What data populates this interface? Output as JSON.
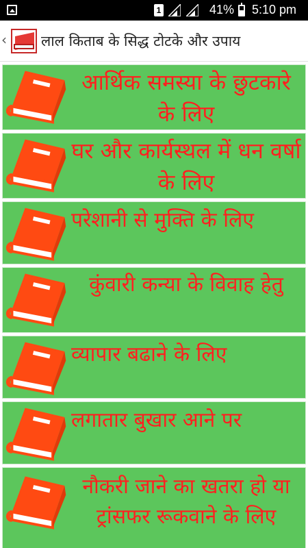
{
  "status_bar": {
    "sim_slot": "1",
    "battery_percent": "41%",
    "time": "5:10 pm"
  },
  "app_bar": {
    "back_icon": "chevron-left-icon",
    "app_icon": "red-book-icon",
    "title": "लाल किताब के सिद्ध टोटके और उपाय"
  },
  "colors": {
    "item_bg": "#5cc65c",
    "item_text": "#ff1f1f",
    "book_icon": "#ff4a12"
  },
  "items": [
    {
      "label": "आर्थिक समस्या के छुटकारे के लिए",
      "icon": "book-icon"
    },
    {
      "label": "घर और कार्यस्थल में धन वर्षा के लिए",
      "icon": "book-icon"
    },
    {
      "label": "परेशानी से मुक्ति के लिए",
      "icon": "book-icon"
    },
    {
      "label": "कुंवारी कन्या के विवाह हेतु",
      "icon": "book-icon"
    },
    {
      "label": "व्यापार बढाने के लिए",
      "icon": "book-icon"
    },
    {
      "label": "लगातार बुखार आने पर",
      "icon": "book-icon"
    },
    {
      "label": "नौकरी जाने का खतरा हो या ट्रांसफर रूकवाने के लिए",
      "icon": "book-icon"
    }
  ]
}
